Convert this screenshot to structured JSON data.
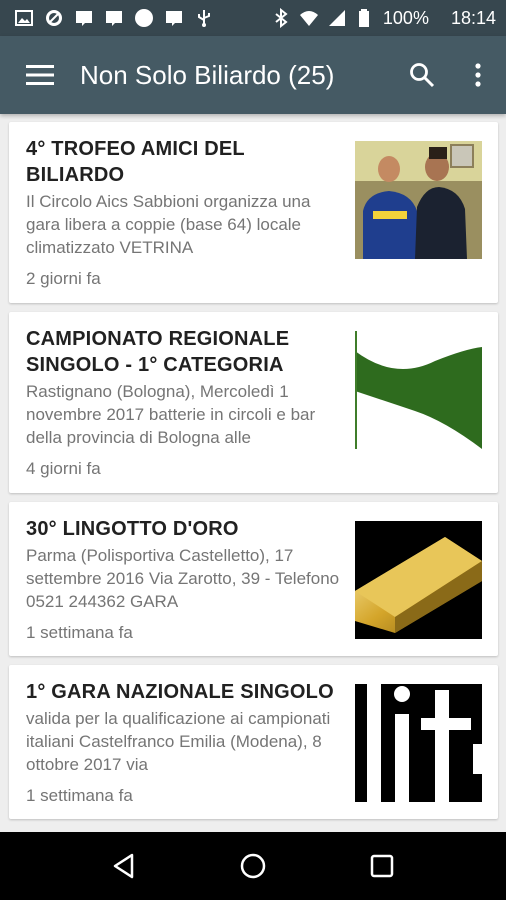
{
  "status_bar": {
    "battery": "100%",
    "time": "18:14",
    "icons_left": [
      "image-icon",
      "blocked-icon",
      "message-icon",
      "message-icon",
      "circle-icon",
      "message-icon",
      "usb-icon"
    ],
    "icons_right": [
      "bluetooth-icon",
      "wifi-icon",
      "signal-icon",
      "battery-icon"
    ]
  },
  "app_bar": {
    "title": "Non Solo Biliardo (25)",
    "icons": [
      "menu-icon",
      "search-icon",
      "overflow-icon"
    ],
    "background": "#455a64"
  },
  "articles": [
    {
      "title": "4° TROFEO AMICI DEL BILIARDO",
      "description": "Il Circolo Aics Sabbioni organizza una gara libera a coppie (base 64) locale climatizzato VETRINA",
      "time": "2 giorni fa"
    },
    {
      "title": "CAMPIONATO REGIONALE SINGOLO - 1° CATEGORIA",
      "description": "Rastignano (Bologna), Mercoledì 1 novembre 2017 batterie in circoli e bar della provincia di Bologna alle",
      "time": "4 giorni fa"
    },
    {
      "title": "30° LINGOTTO D'ORO",
      "description": "Parma (Polisportiva Castelletto), 17 settembre 2016 Via Zarotto, 39 - Telefono 0521 244362  GARA",
      "time": "1 settimana fa"
    },
    {
      "title": "1° GARA NAZIONALE SINGOLO",
      "description": "valida per la qualificazione ai campionati italiani Castelfranco Emilia (Modena), 8 ottobre 2017 via",
      "time": "1 settimana fa"
    }
  ],
  "nav_bar": {
    "icons": [
      "back-icon",
      "home-icon",
      "recents-icon"
    ]
  }
}
